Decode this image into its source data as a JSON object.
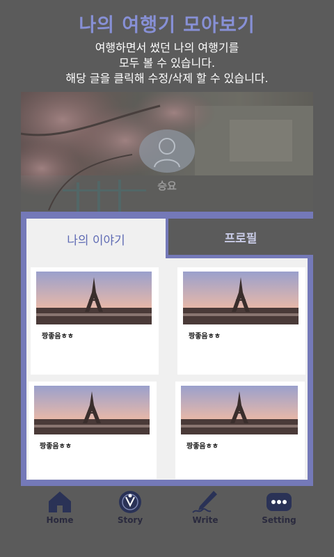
{
  "header": {
    "title": "나의 여행기 모아보기",
    "subtitle_lines": [
      "여행하면서 썼던 나의 여행기를",
      "모두 볼 수 있습니다.",
      "해당 글을 클릭해 수정/삭제 할 수 있습니다."
    ]
  },
  "profile": {
    "name": "승요"
  },
  "tabs": [
    {
      "label": "나의 이야기",
      "active": true
    },
    {
      "label": "프로필",
      "active": false
    }
  ],
  "cards": [
    {
      "caption": "짱좋음ㅎㅎ"
    },
    {
      "caption": "짱좋음ㅎㅎ"
    },
    {
      "caption": "짱좋음ㅎㅎ"
    },
    {
      "caption": "짱좋음ㅎㅎ"
    }
  ],
  "bottom_nav": [
    {
      "label": "Home",
      "icon": "home-icon"
    },
    {
      "label": "Story",
      "icon": "story-icon"
    },
    {
      "label": "Write",
      "icon": "pen-icon"
    },
    {
      "label": "Setting",
      "icon": "more-icon"
    }
  ],
  "colors": {
    "accent": "#7479b8",
    "title": "#8790d6",
    "background": "#5b5b5b"
  }
}
